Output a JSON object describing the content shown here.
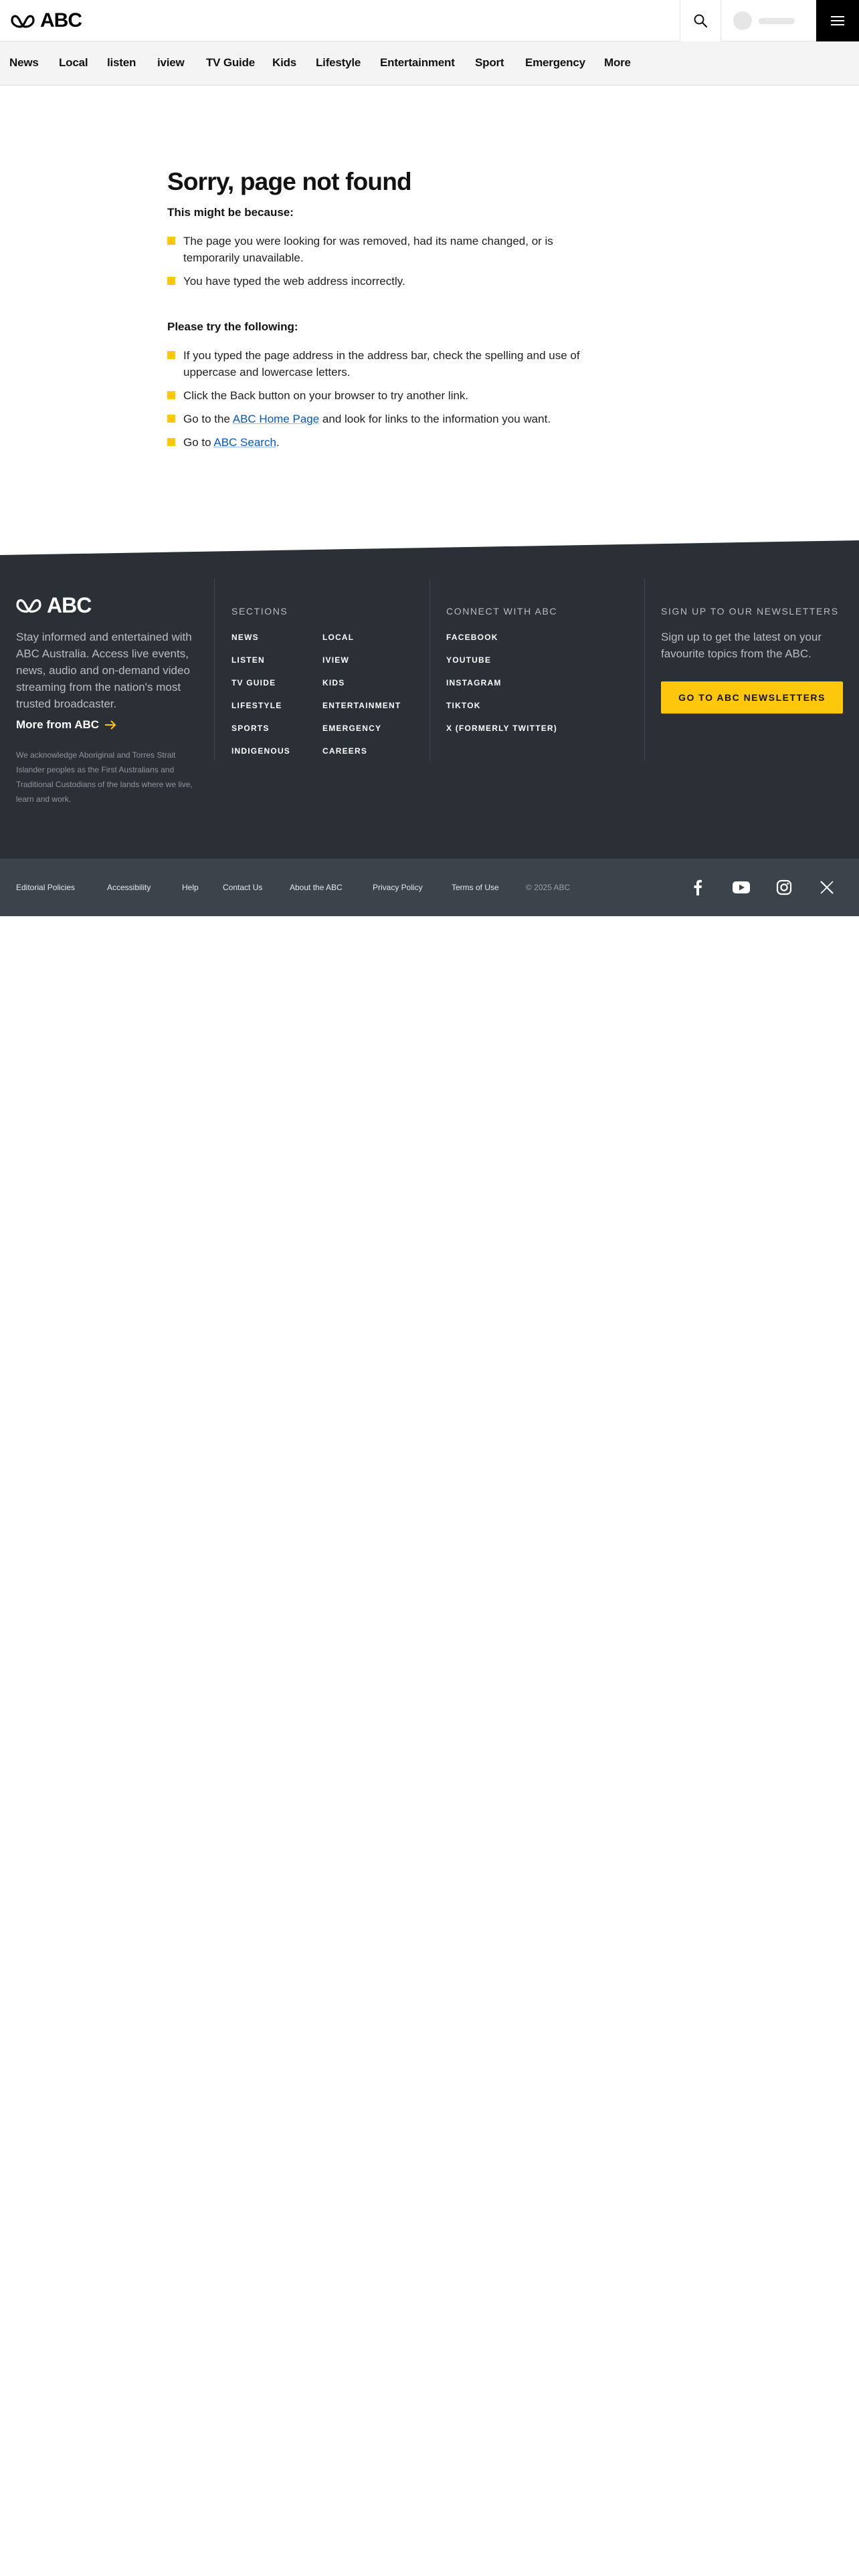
{
  "header": {
    "brand": "ABC",
    "icons": {
      "search": "search-icon",
      "menu": "hamburger-menu-icon",
      "logo": "abc-lissajous-logo-icon"
    }
  },
  "nav": {
    "items": [
      "News",
      "Local",
      "listen",
      "iview",
      "TV Guide",
      "Kids",
      "Lifestyle",
      "Entertainment",
      "Sport",
      "Emergency",
      "More"
    ]
  },
  "main": {
    "title": "Sorry, page not found",
    "reasons_heading": "This might be because:",
    "reasons": [
      "The page you were looking for was removed, had its name changed, or is temporarily unavailable.",
      "You have typed the web address incorrectly."
    ],
    "try_heading": "Please try the following:",
    "tips": {
      "tip1": "If you typed the page address in the address bar, check the spelling and use of uppercase and lowercase letters.",
      "tip2": "Click the Back button on your browser to try another link.",
      "tip3_before": "Go to the ",
      "tip3_link": "ABC Home Page",
      "tip3_after": " and look for links to the information you want.",
      "tip4_before": "Go to ",
      "tip4_link": "ABC Search",
      "tip4_after": "."
    },
    "colors": {
      "bullet": "#fdc70c",
      "link": "#0058cc"
    }
  },
  "footer": {
    "brand": "ABC",
    "description": "Stay informed and entertained with ABC Australia. Access live events, news, audio and on-demand video streaming from the nation's most trusted broadcaster.",
    "more_label": "More from ABC",
    "acknowledgement": "We acknowledge Aboriginal and Torres Strait Islander peoples as the First Australians and Traditional Custodians of the lands where we live, learn and work.",
    "sections_heading": "SECTIONS",
    "sections_col1": [
      "NEWS",
      "LISTEN",
      "TV GUIDE",
      "LIFESTYLE",
      "SPORTS",
      "INDIGENOUS"
    ],
    "sections_col2": [
      "LOCAL",
      "IVIEW",
      "KIDS",
      "ENTERTAINMENT",
      "EMERGENCY",
      "CAREERS"
    ],
    "connect_heading": "CONNECT WITH ABC",
    "connect_links": [
      "FACEBOOK",
      "YOUTUBE",
      "INSTAGRAM",
      "TIKTOK",
      "X (FORMERLY TWITTER)"
    ],
    "newsletter_heading": "SIGN UP TO OUR NEWSLETTERS",
    "newsletter_text": "Sign up to get the latest on your favourite topics from the ABC.",
    "newsletter_cta": "GO TO ABC NEWSLETTERS",
    "colors": {
      "background": "#2b3036",
      "subfooter": "#3d434a",
      "accent": "#fdc70c"
    }
  },
  "subfooter": {
    "links": [
      "Editorial Policies",
      "Accessibility",
      "Help",
      "Contact Us",
      "About the ABC",
      "Privacy Policy",
      "Terms of Use"
    ],
    "copyright": "© 2025 ABC",
    "social_icons": [
      "facebook-icon",
      "youtube-icon",
      "instagram-icon",
      "x-twitter-icon"
    ]
  }
}
